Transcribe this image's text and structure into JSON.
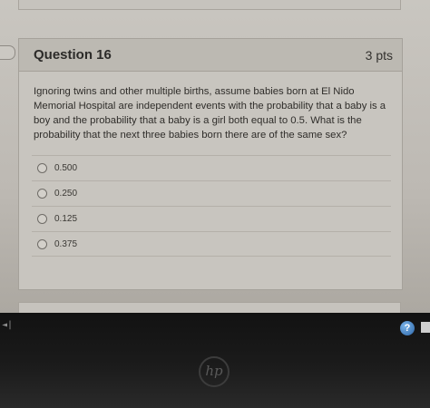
{
  "question": {
    "title": "Question 16",
    "points": "3 pts",
    "text": "Ignoring twins and other multiple births, assume babies born at El Nido Memorial Hospital are independent events with the probability that a baby is a boy and the probability that a baby is a girl both equal to 0.5. What is the probability that the next three babies born there are of the same sex?"
  },
  "answers": [
    {
      "label": "0.500"
    },
    {
      "label": "0.250"
    },
    {
      "label": "0.125"
    },
    {
      "label": "0.375"
    }
  ],
  "bezel": {
    "help_glyph": "?",
    "logo_text": "hp"
  },
  "colors": {
    "card_bg": "#c8c5bf",
    "header_bg": "#bcb9b2",
    "bezel_bg": "#121212"
  }
}
